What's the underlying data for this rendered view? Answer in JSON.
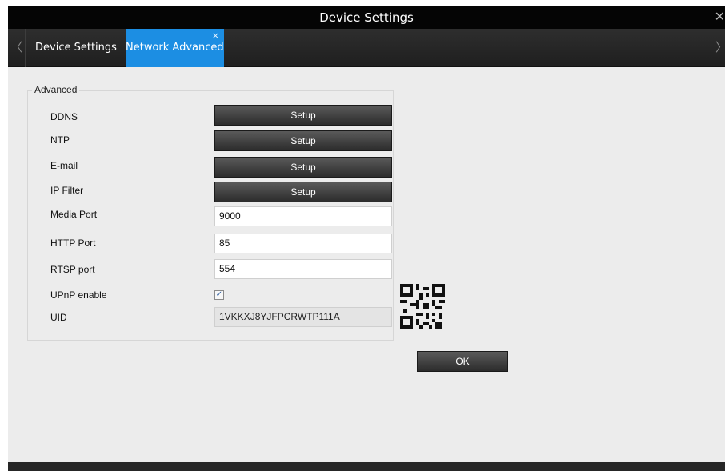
{
  "window": {
    "title": "Device Settings",
    "close_glyph": "✕"
  },
  "tabs": {
    "prev_glyph": "〈",
    "next_glyph": "〉",
    "items": [
      {
        "label": "Device Settings",
        "active": false
      },
      {
        "label": "Network Advanced",
        "active": true,
        "close_glyph": "×"
      }
    ]
  },
  "advanced": {
    "legend": "Advanced",
    "ddns_label": "DDNS",
    "ntp_label": "NTP",
    "email_label": "E-mail",
    "ipfilter_label": "IP Filter",
    "setup_label": "Setup",
    "media_port_label": "Media Port",
    "media_port_value": "9000",
    "http_port_label": "HTTP Port",
    "http_port_value": "85",
    "rtsp_port_label": "RTSP port",
    "rtsp_port_value": "554",
    "upnp_label": "UPnP enable",
    "upnp_checked": true,
    "upnp_glyph": "✓",
    "uid_label": "UID",
    "uid_value": "1VKKXJ8YJFPCRWTP111A"
  },
  "footer": {
    "ok_label": "OK"
  },
  "icons": {
    "window_close": "close-icon",
    "tab_prev": "chevron-left-icon",
    "tab_next": "chevron-right-icon",
    "tab_close": "close-icon",
    "uid_qr": "qr-code-icon"
  },
  "colors": {
    "active_tab": "#1c8ee3",
    "titlebar": "#050505",
    "panel": "#ececec"
  }
}
